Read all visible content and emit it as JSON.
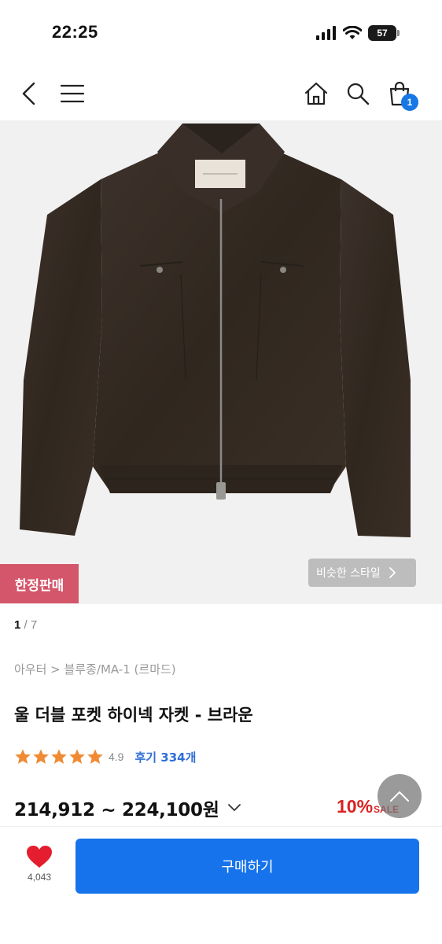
{
  "status_bar": {
    "time": "22:25",
    "battery": "57"
  },
  "nav": {
    "cart_count": "1"
  },
  "hero": {
    "limited_badge": "한정판매",
    "similar_style": "비슷한 스타일"
  },
  "image_counter": {
    "current": "1",
    "total": "7"
  },
  "breadcrumb": "아우터 > 블루종/MA-1 (르마드)",
  "product": {
    "title": "울 더블 포켓 하이넥 자켓 - 브라운",
    "rating": "4.9",
    "stars": 5,
    "reviews": "후기 334개",
    "price": "214,912 ~ 224,100원",
    "discount_rate": "10%",
    "discount_label": "SALE"
  },
  "bottom": {
    "like_count": "4,043",
    "buy_label": "구매하기"
  },
  "colors": {
    "accent_blue": "#1673ec",
    "badge_pink": "#d4566a",
    "sale_red": "#d92323",
    "star_orange": "#f08a33"
  }
}
